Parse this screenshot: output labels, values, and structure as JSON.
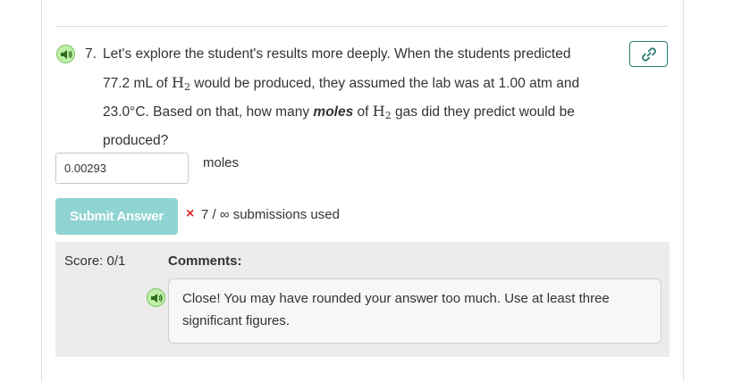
{
  "question": {
    "number": "7.",
    "text_1": "Let's explore the student's results more deeply. When the students predicted",
    "volume": "77.2 mL of",
    "chem_1": "H",
    "chem_1_sub": "2",
    "text_2": "would be produced, they assumed the lab was at 1.00 atm and",
    "text_3": "23.0°C. Based on that, how many",
    "emphasis": "moles",
    "text_4": "of",
    "chem_2": "H",
    "chem_2_sub": "2",
    "text_5": "gas did they predict would be",
    "text_6": "produced?"
  },
  "answer": {
    "value": "0.00293",
    "unit": "moles"
  },
  "submit": {
    "label": "Submit Answer",
    "status_mark": "×",
    "submissions": "7 / ∞ submissions used"
  },
  "score": {
    "label": "Score: 0/1"
  },
  "comments": {
    "label": "Comments:",
    "text": "Close! You may have rounded your answer too much. Use at least three significant figures."
  },
  "colors": {
    "accent": "#2a7a74",
    "submit_bg": "#8fd3d2",
    "error": "#d42a2a",
    "speaker_bg": "#bff0a8"
  },
  "icons": [
    "speaker-icon",
    "link-icon"
  ]
}
